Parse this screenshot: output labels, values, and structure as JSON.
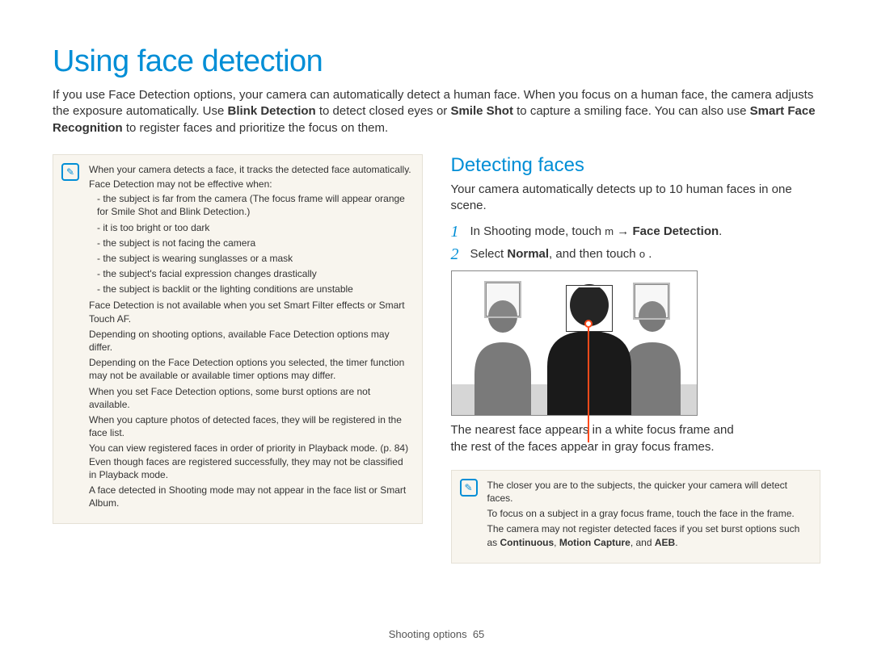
{
  "title": "Using face detection",
  "intro": {
    "text_a": "If you use Face Detection options, your camera can automatically detect a human face. When you focus on a human face, the camera adjusts the exposure automatically. Use ",
    "bold_a": "Blink Detection",
    "text_b": " to detect closed eyes or ",
    "bold_b": "Smile Shot",
    "text_c": " to capture a smiling face. You can also use ",
    "bold_c": "Smart Face Recognition",
    "text_d": " to register faces and prioritize the focus on them."
  },
  "note_left": {
    "items": [
      "When your camera detects a face, it tracks the detected face automatically.",
      "Face Detection may not be effective when:"
    ],
    "sub_items": [
      "the subject is far from the camera (The focus frame will appear orange for Smile Shot and Blink Detection.)",
      "it is too bright or too dark",
      "the subject is not facing the camera",
      "the subject is wearing sunglasses or a mask",
      "the subject's facial expression changes drastically",
      "the subject is backlit or the lighting conditions are unstable"
    ],
    "items_after": [
      "Face Detection is not available when you set Smart Filter effects or Smart Touch AF.",
      "Depending on shooting options, available Face Detection options may differ.",
      "Depending on the Face Detection options you selected, the timer function may not be available or available timer options may differ.",
      "When you set Face Detection options, some burst options are not available.",
      "When you capture photos of detected faces, they will be registered in the face list.",
      "You can view registered faces in order of priority in Playback mode. (p. 84) Even though faces are registered successfully, they may not be classified in Playback mode.",
      "A face detected in Shooting mode may not appear in the face list or Smart Album."
    ]
  },
  "right": {
    "section_title": "Detecting faces",
    "section_desc": "Your camera automatically detects up to 10 human faces in one scene.",
    "steps": [
      {
        "num": "1",
        "prefix": "In Shooting mode, touch ",
        "icon": "m",
        "mid": "  → ",
        "bold": "Face Detection",
        "suffix": "."
      },
      {
        "num": "2",
        "prefix": "Select ",
        "bold": "Normal",
        "mid": ", and then touch ",
        "icon": "o",
        "suffix": "  ."
      }
    ],
    "caption_a": "The nearest face appears in a white focus frame and",
    "caption_b": "the rest of the faces appear in gray focus frames.",
    "note": {
      "line1": "The closer you are to the subjects, the quicker your camera will detect faces.",
      "line2": "To focus on a subject in a gray focus frame, touch the face in the frame.",
      "line3_a": "The camera may not register detected faces if you set burst options such as ",
      "bold_a": "Continuous",
      "sep_a": ", ",
      "bold_b": "Motion Capture",
      "sep_b": ", and ",
      "bold_c": "AEB",
      "suffix": "."
    }
  },
  "footer": {
    "section": "Shooting options",
    "page": "65"
  },
  "icons": {
    "note": "✎"
  }
}
